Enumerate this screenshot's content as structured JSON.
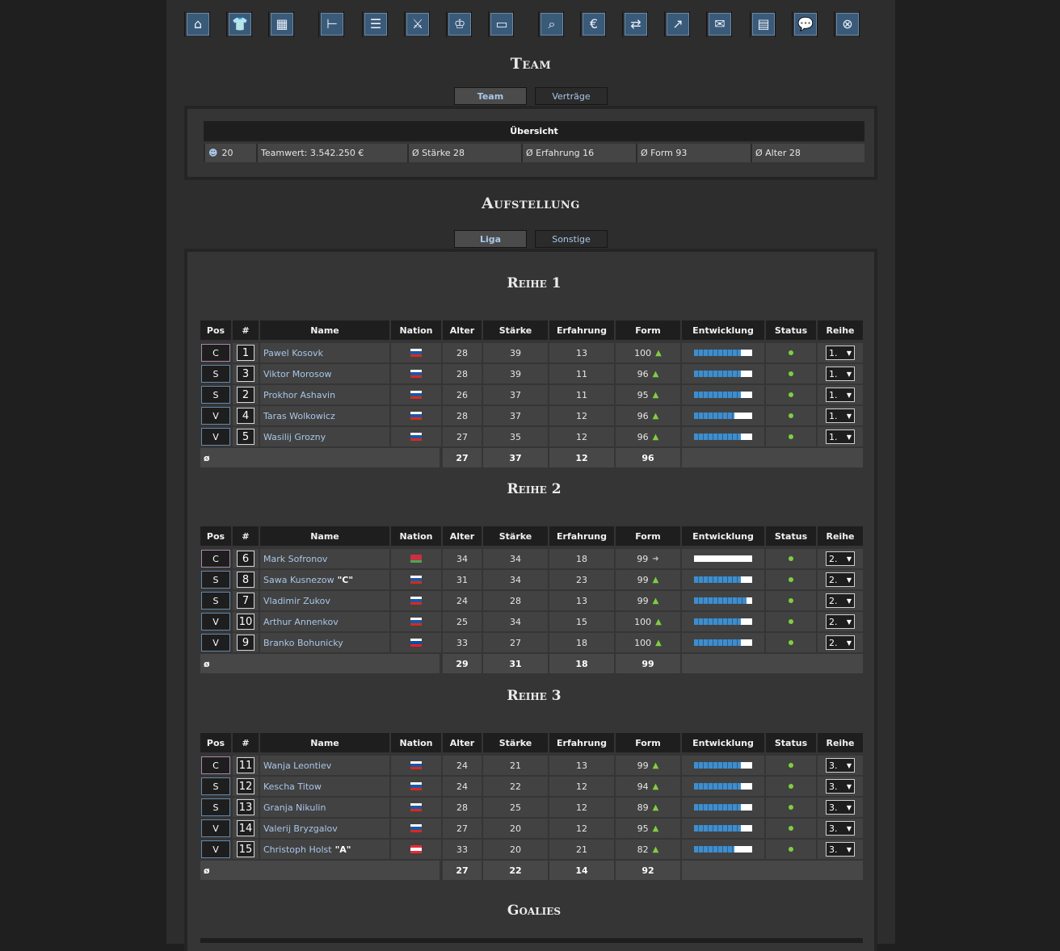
{
  "nav": [
    {
      "icon": "home-icon",
      "glyph": "⌂"
    },
    {
      "icon": "jersey-icon",
      "glyph": "👕"
    },
    {
      "icon": "tactics-board-icon",
      "glyph": "▦"
    },
    {
      "icon": "training-icon",
      "glyph": "⊢"
    },
    {
      "icon": "list-icon",
      "glyph": "☰"
    },
    {
      "icon": "versus-icon",
      "glyph": "⚔"
    },
    {
      "icon": "trophy-icon",
      "glyph": "♔"
    },
    {
      "icon": "rink-icon",
      "glyph": "▭"
    },
    {
      "icon": "scout-icon",
      "glyph": "⌕"
    },
    {
      "icon": "finances-icon",
      "glyph": "€"
    },
    {
      "icon": "transfer-icon",
      "glyph": "⇄"
    },
    {
      "icon": "statistics-icon",
      "glyph": "↗"
    },
    {
      "icon": "mail-icon",
      "glyph": "✉"
    },
    {
      "icon": "table-icon",
      "glyph": "▤"
    },
    {
      "icon": "chat-icon",
      "glyph": "💬"
    },
    {
      "icon": "logout-icon",
      "glyph": "⊗"
    }
  ],
  "team_title": "Team",
  "team_tabs": [
    "Team",
    "Verträge"
  ],
  "overview": {
    "title": "Übersicht",
    "players": "20",
    "teamwert": "Teamwert: 3.542.250 €",
    "staerke": "Ø Stärke 28",
    "erfahrung": "Ø Erfahrung 16",
    "form": "Ø Form 93",
    "alter": "Ø Alter 28"
  },
  "lineup_title": "Aufstellung",
  "lineup_tabs": [
    "Liga",
    "Sonstige"
  ],
  "headers": [
    "Pos",
    "#",
    "Name",
    "Nation",
    "Alter",
    "Stärke",
    "Erfahrung",
    "Form",
    "Entwicklung",
    "Status",
    "Reihe"
  ],
  "avg_label": "ø",
  "lines": [
    {
      "title": "Reihe 1",
      "players": [
        {
          "pos": "C",
          "num": "1",
          "name": "Pawel Kosovk",
          "tag": "",
          "flag": "ru",
          "age": "28",
          "str": "39",
          "exp": "13",
          "form": "100",
          "trend": "up",
          "dev": 0.8,
          "reihe": "1."
        },
        {
          "pos": "S",
          "num": "3",
          "name": "Viktor Morosow",
          "tag": "",
          "flag": "ru",
          "age": "28",
          "str": "39",
          "exp": "11",
          "form": "96",
          "trend": "up",
          "dev": 0.8,
          "reihe": "1."
        },
        {
          "pos": "S",
          "num": "2",
          "name": "Prokhor Ashavin",
          "tag": "",
          "flag": "ru",
          "age": "26",
          "str": "37",
          "exp": "11",
          "form": "95",
          "trend": "up",
          "dev": 0.8,
          "reihe": "1."
        },
        {
          "pos": "V",
          "num": "4",
          "name": "Taras Wolkowicz",
          "tag": "",
          "flag": "ru",
          "age": "28",
          "str": "37",
          "exp": "12",
          "form": "96",
          "trend": "up",
          "dev": 0.7,
          "reihe": "1."
        },
        {
          "pos": "V",
          "num": "5",
          "name": "Wasilij Grozny",
          "tag": "",
          "flag": "ru",
          "age": "27",
          "str": "35",
          "exp": "12",
          "form": "96",
          "trend": "up",
          "dev": 0.8,
          "reihe": "1."
        }
      ],
      "avg": {
        "age": "27",
        "str": "37",
        "exp": "12",
        "form": "96"
      }
    },
    {
      "title": "Reihe 2",
      "players": [
        {
          "pos": "C",
          "num": "6",
          "name": "Mark Sofronov",
          "tag": "",
          "flag": "by",
          "age": "34",
          "str": "34",
          "exp": "18",
          "form": "99",
          "trend": "eq",
          "dev": 0.0,
          "reihe": "2."
        },
        {
          "pos": "S",
          "num": "8",
          "name": "Sawa Kusnezow",
          "tag": "\"C\"",
          "flag": "ru",
          "age": "31",
          "str": "34",
          "exp": "23",
          "form": "99",
          "trend": "up",
          "dev": 0.8,
          "reihe": "2."
        },
        {
          "pos": "S",
          "num": "7",
          "name": "Vladimir Zukov",
          "tag": "",
          "flag": "ru",
          "age": "24",
          "str": "28",
          "exp": "13",
          "form": "99",
          "trend": "up",
          "dev": 0.9,
          "reihe": "2."
        },
        {
          "pos": "V",
          "num": "10",
          "name": "Arthur Annenkov",
          "tag": "",
          "flag": "ru",
          "age": "25",
          "str": "34",
          "exp": "15",
          "form": "100",
          "trend": "up",
          "dev": 0.8,
          "reihe": "2."
        },
        {
          "pos": "V",
          "num": "9",
          "name": "Branko Bohunicky",
          "tag": "",
          "flag": "sk",
          "age": "33",
          "str": "27",
          "exp": "18",
          "form": "100",
          "trend": "up",
          "dev": 0.8,
          "reihe": "2."
        }
      ],
      "avg": {
        "age": "29",
        "str": "31",
        "exp": "18",
        "form": "99"
      }
    },
    {
      "title": "Reihe 3",
      "players": [
        {
          "pos": "C",
          "num": "11",
          "name": "Wanja Leontiev",
          "tag": "",
          "flag": "ru",
          "age": "24",
          "str": "21",
          "exp": "13",
          "form": "99",
          "trend": "up",
          "dev": 0.8,
          "reihe": "3."
        },
        {
          "pos": "S",
          "num": "12",
          "name": "Kescha Titow",
          "tag": "",
          "flag": "ru",
          "age": "24",
          "str": "22",
          "exp": "12",
          "form": "94",
          "trend": "up",
          "dev": 0.8,
          "reihe": "3."
        },
        {
          "pos": "S",
          "num": "13",
          "name": "Granja Nikulin",
          "tag": "",
          "flag": "ru",
          "age": "28",
          "str": "25",
          "exp": "12",
          "form": "89",
          "trend": "up",
          "dev": 0.8,
          "reihe": "3."
        },
        {
          "pos": "V",
          "num": "14",
          "name": "Valerij Bryzgalov",
          "tag": "",
          "flag": "ru",
          "age": "27",
          "str": "20",
          "exp": "12",
          "form": "95",
          "trend": "up",
          "dev": 0.8,
          "reihe": "3."
        },
        {
          "pos": "V",
          "num": "15",
          "name": "Christoph Holst",
          "tag": "\"A\"",
          "flag": "at",
          "age": "33",
          "str": "20",
          "exp": "21",
          "form": "82",
          "trend": "up",
          "dev": 0.7,
          "reihe": "3."
        }
      ],
      "avg": {
        "age": "27",
        "str": "22",
        "exp": "14",
        "form": "92"
      }
    }
  ],
  "goalies_title": "Goalies",
  "flags": {
    "ru": [
      "#ffffff",
      "#1c57a5",
      "#d52b1e"
    ],
    "by": [
      "#c8313e",
      "#c8313e",
      "#4aa657"
    ],
    "sk": [
      "#ffffff",
      "#0b4ea2",
      "#ee1c25"
    ],
    "at": [
      "#ed2939",
      "#ffffff",
      "#ed2939"
    ]
  },
  "colors": {
    "link": "#a9c7e8",
    "status_ok": "#7fcf3f",
    "dev_bar": "#3f8dcc"
  }
}
